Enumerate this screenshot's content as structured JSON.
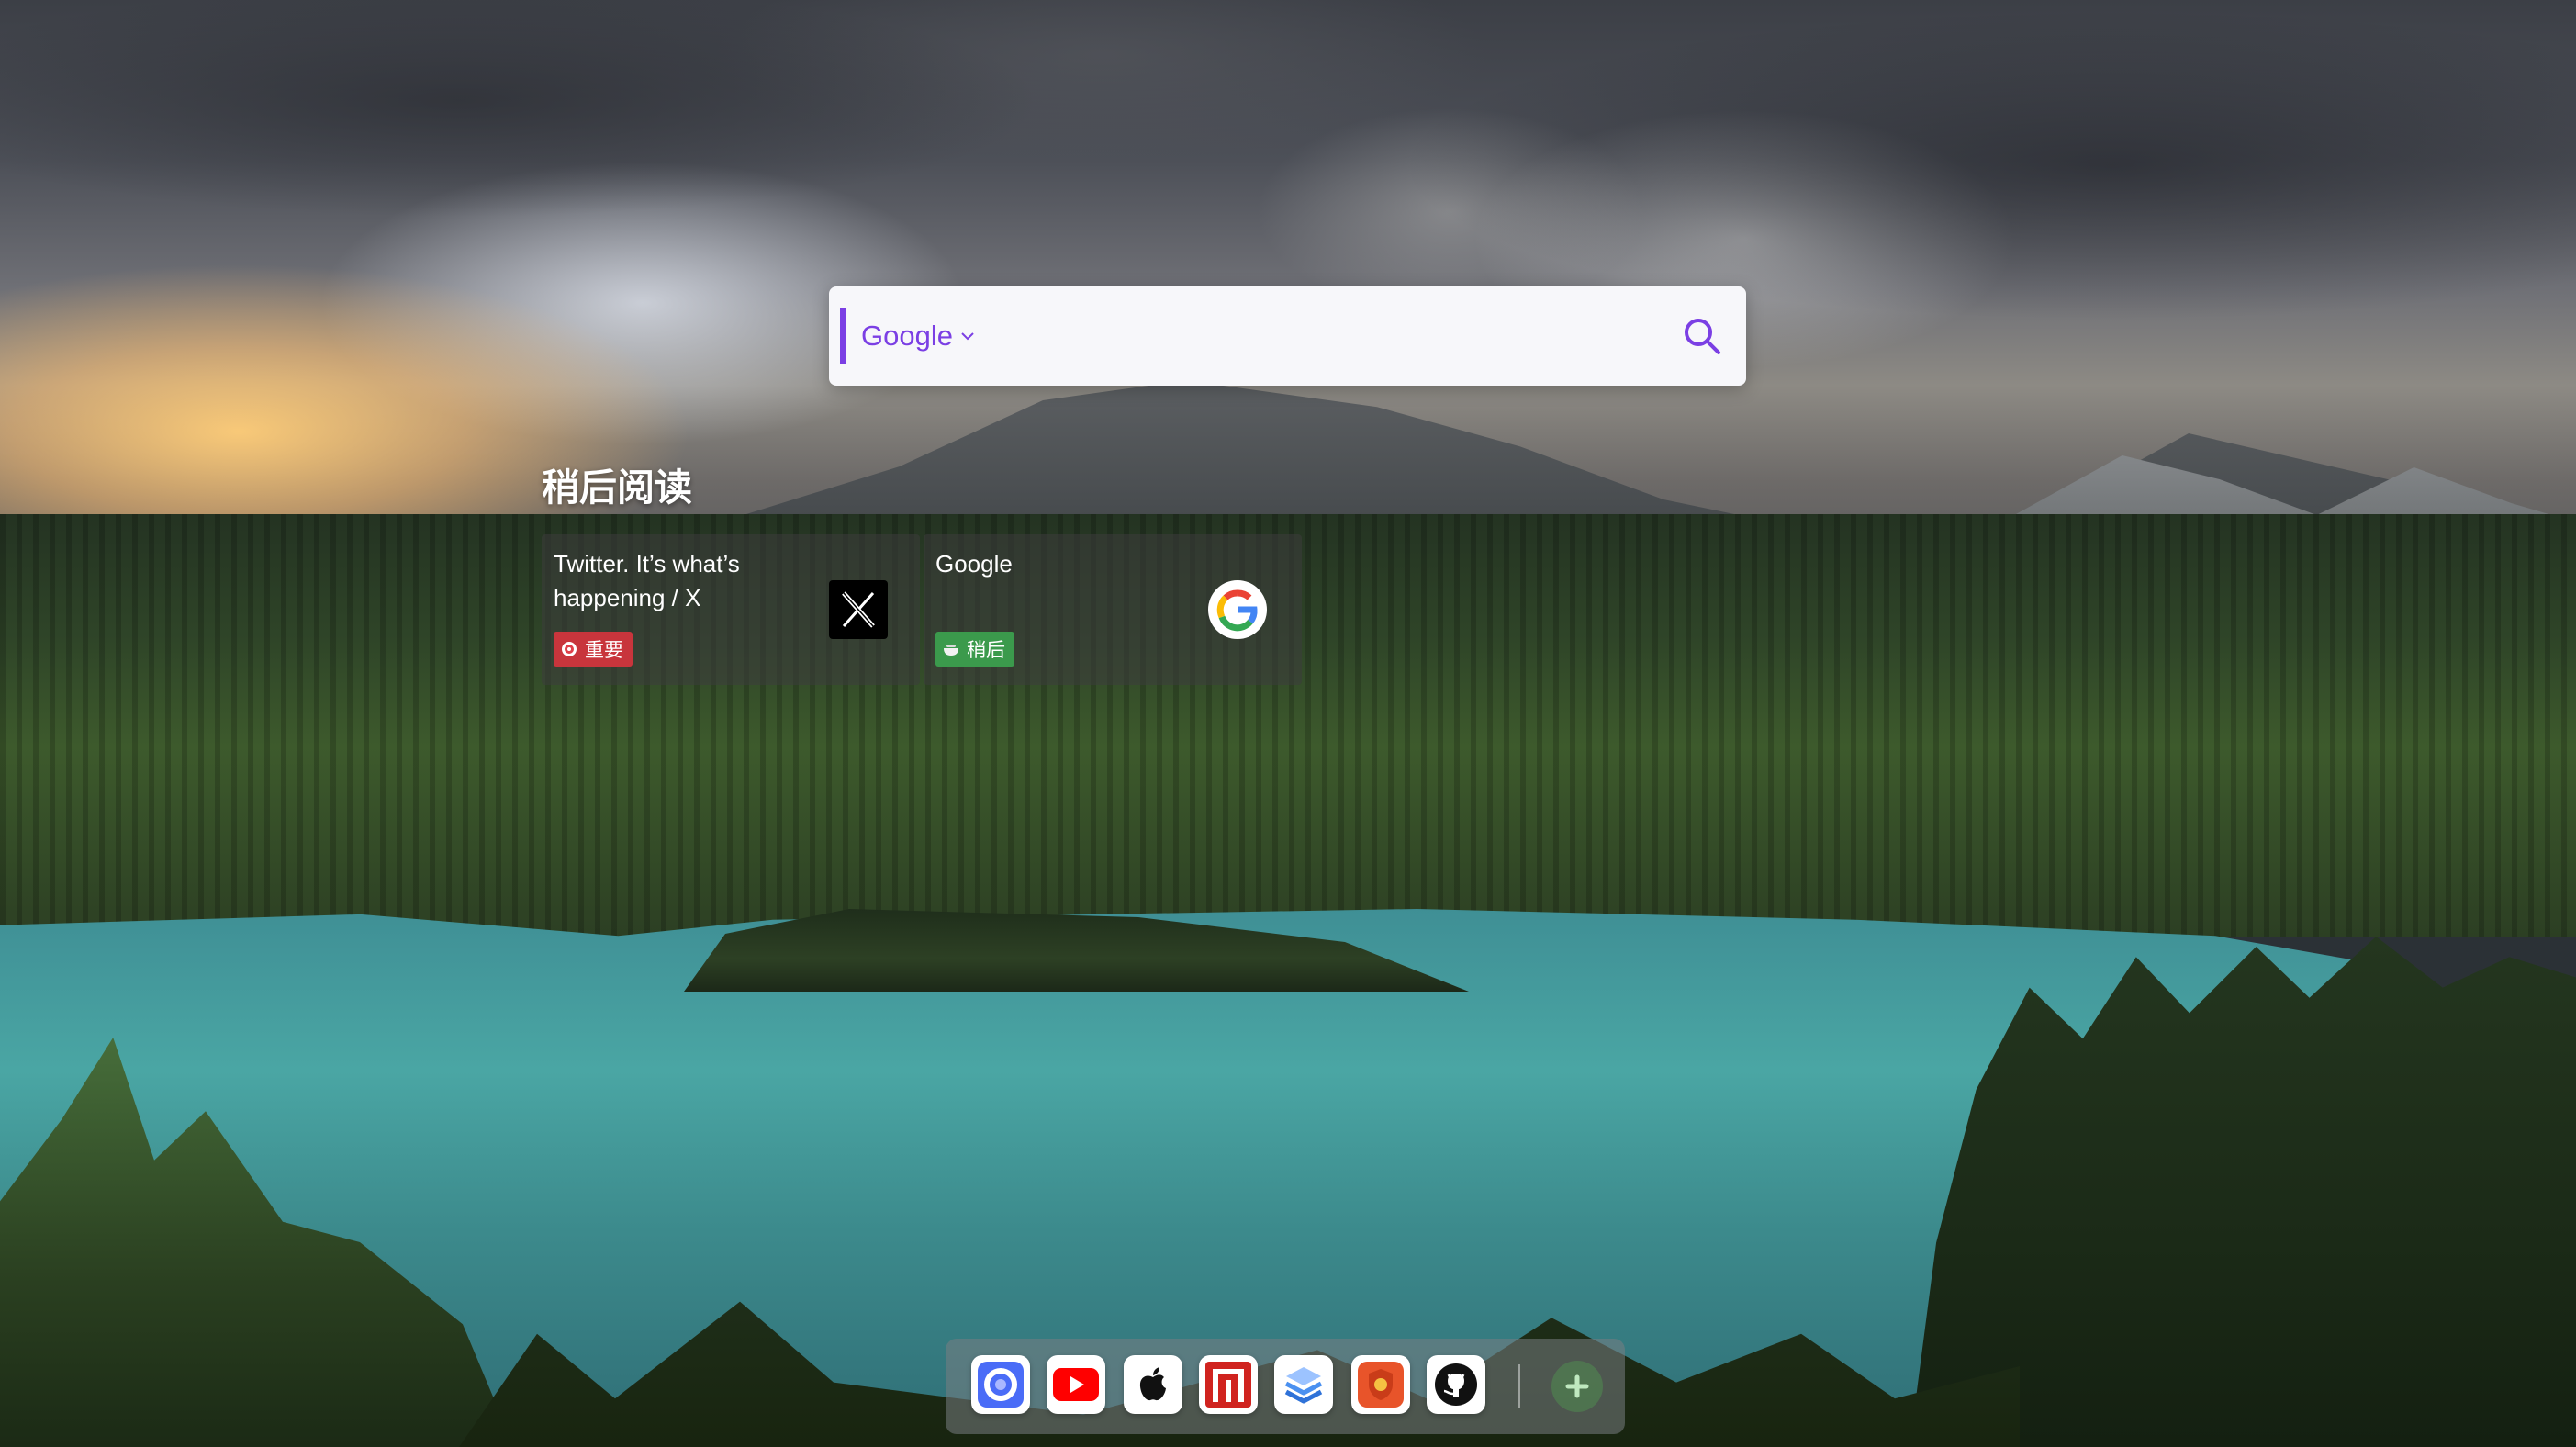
{
  "search": {
    "engine_label": "Google",
    "query": "",
    "placeholder": ""
  },
  "read_later": {
    "title": "稍后阅读",
    "cards": [
      {
        "title": "Twitter. It’s what’s happening / X",
        "tag": "重要",
        "icon": "x-logo-icon"
      },
      {
        "title": "Google",
        "tag": "稍后",
        "icon": "google-logo-icon"
      }
    ]
  },
  "dock": {
    "apps": [
      {
        "name": "app-blue-circle",
        "icon": "blue-circle-app-icon",
        "color": "#4a6cf7"
      },
      {
        "name": "youtube",
        "icon": "youtube-icon",
        "color": "#ff0000"
      },
      {
        "name": "apple",
        "icon": "apple-icon",
        "color": "#ffffff"
      },
      {
        "name": "netease",
        "icon": "red-n-icon",
        "color": "#d0231f"
      },
      {
        "name": "layers",
        "icon": "layers-icon",
        "color": "#4a90f0"
      },
      {
        "name": "shield-app",
        "icon": "orange-shield-icon",
        "color": "#e8542a"
      },
      {
        "name": "github",
        "icon": "github-icon",
        "color": "#ffffff"
      }
    ],
    "add_icon": "plus-icon"
  },
  "colors": {
    "accent": "#7b3fe4",
    "tag_important": "#c8353c",
    "tag_later": "#3b9a4c"
  }
}
